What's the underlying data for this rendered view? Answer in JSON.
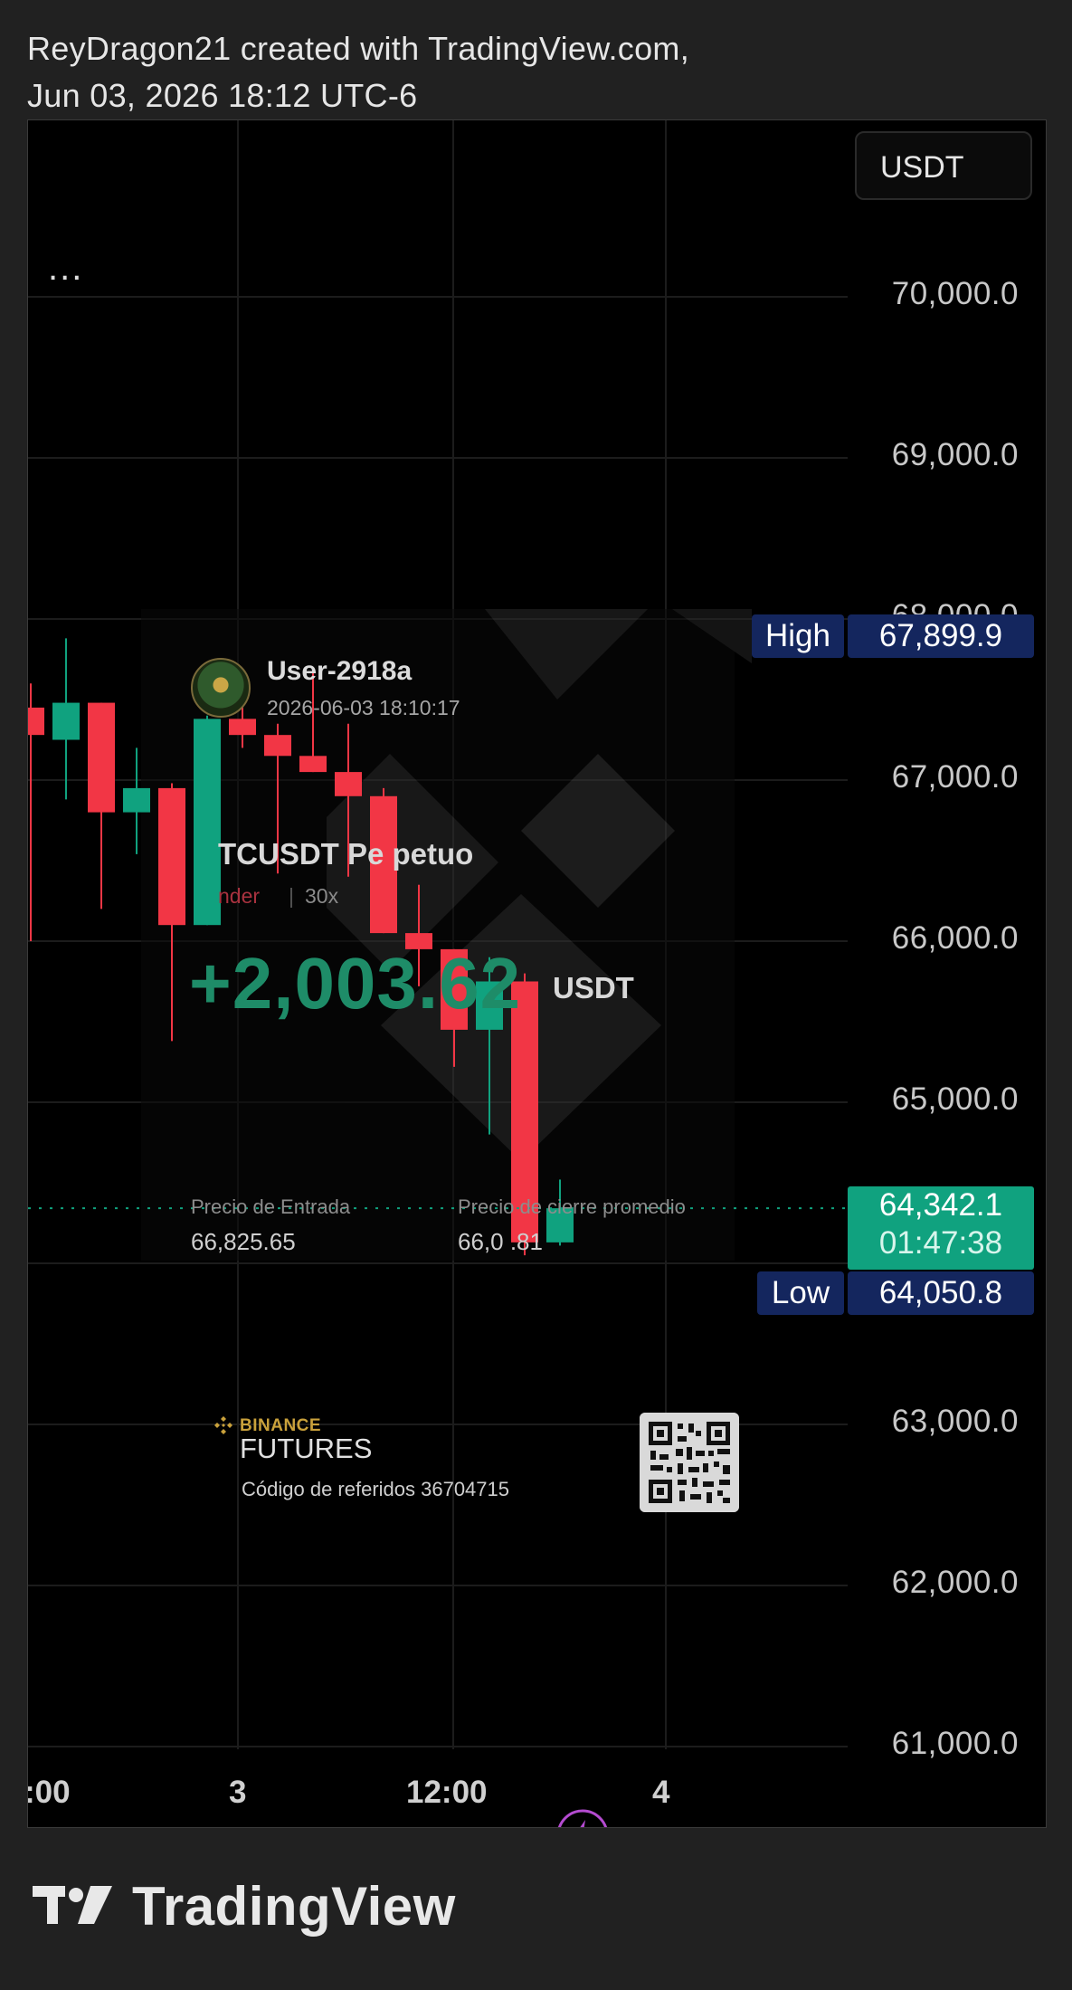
{
  "header": {
    "line1": "ReyDragon21 created with TradingView.com,",
    "line2": "Jun 03, 2026 18:12 UTC-6"
  },
  "toolbar": {
    "menu_icon": "ellipsis-icon",
    "menu_label": "..."
  },
  "currency_selector": {
    "value": "USDT"
  },
  "price_axis": {
    "ticks": [
      "70,000.0",
      "69,000.0",
      "68,000.0",
      "67,000.0",
      "66,000.0",
      "65,000.0",
      "63,000.0",
      "62,000.0",
      "61,000.0"
    ]
  },
  "high_marker": {
    "label": "High",
    "value": "67,899.9"
  },
  "low_marker": {
    "label": "Low",
    "value": "64,050.8"
  },
  "current_price": {
    "value": "64,342.1",
    "countdown": "01:47:38"
  },
  "time_axis": {
    "labels": [
      ":00",
      "3",
      "12:00",
      "4"
    ]
  },
  "pnl_card": {
    "username": "User-2918a",
    "timestamp": "2026-06-03 18:10:17",
    "pair": "TCUSDT Pe petuo",
    "side": "nder",
    "leverage": "30x",
    "pnl": "+2,003.62",
    "pnl_unit": "USDT",
    "entry_label": "Precio de Entrada",
    "entry_value": "66,825.65",
    "close_label": "Precio de cierre promedio",
    "close_value": "66,0  .81"
  },
  "referral": {
    "brand": "BINANCE",
    "product": "FUTURES",
    "code_text": "Código de referidos 36704715"
  },
  "footer": {
    "logo_icon": "tradingview-logo-icon",
    "name": "TradingView"
  },
  "colors": {
    "up": "#10a27f",
    "down": "#f23645",
    "high_low_bg": "#14265e",
    "binance_gold": "#c9a13b"
  },
  "chart_data": {
    "type": "candlestick",
    "symbol_quote": "USDT",
    "y_axis_range": [
      61000,
      70000
    ],
    "high": 67899.9,
    "low": 64050.8,
    "last": 64342.1,
    "candles": [
      {
        "o": 67450,
        "h": 67600,
        "c": 67280,
        "l": 66000
      },
      {
        "o": 67250,
        "h": 67880,
        "c": 67480,
        "l": 66880
      },
      {
        "o": 67480,
        "h": 67480,
        "c": 66800,
        "l": 66200
      },
      {
        "o": 66800,
        "h": 67200,
        "c": 66950,
        "l": 66540
      },
      {
        "o": 66950,
        "h": 66980,
        "c": 66100,
        "l": 65380
      },
      {
        "o": 66100,
        "h": 67400,
        "c": 67380,
        "l": 66100
      },
      {
        "o": 67380,
        "h": 67480,
        "c": 67280,
        "l": 67200
      },
      {
        "o": 67280,
        "h": 67350,
        "c": 67150,
        "l": 66420
      },
      {
        "o": 67150,
        "h": 67700,
        "c": 67050,
        "l": 67050
      },
      {
        "o": 67050,
        "h": 67350,
        "c": 66900,
        "l": 66400
      },
      {
        "o": 66900,
        "h": 66950,
        "c": 66050,
        "l": 66050
      },
      {
        "o": 66050,
        "h": 66350,
        "c": 65950,
        "l": 65720
      },
      {
        "o": 65950,
        "h": 65950,
        "c": 65450,
        "l": 65220
      },
      {
        "o": 65450,
        "h": 65900,
        "c": 65750,
        "l": 64800
      },
      {
        "o": 65750,
        "h": 65800,
        "c": 64130,
        "l": 64050
      },
      {
        "o": 64130,
        "h": 64520,
        "c": 64342,
        "l": 64110
      }
    ]
  }
}
